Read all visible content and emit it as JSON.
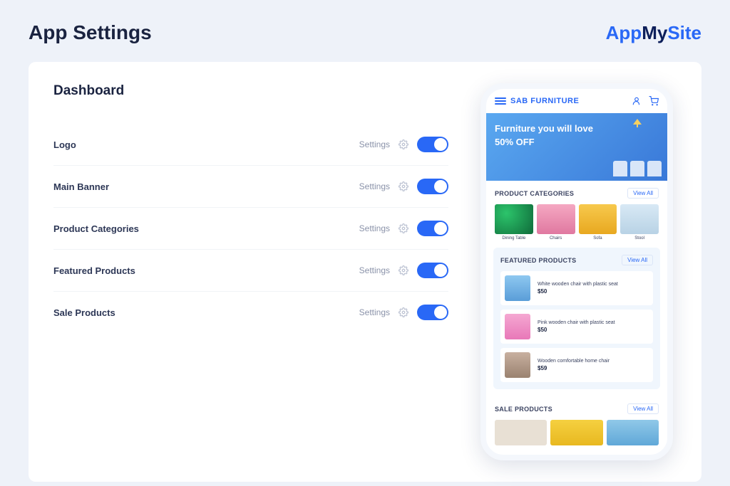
{
  "page": {
    "title": "App Settings"
  },
  "brand": {
    "part1": "App",
    "part2": "My",
    "part3": "Site"
  },
  "panel": {
    "title": "Dashboard",
    "settings_label": "Settings",
    "rows": [
      {
        "label": "Logo"
      },
      {
        "label": "Main Banner"
      },
      {
        "label": "Product Categories"
      },
      {
        "label": "Featured Products"
      },
      {
        "label": "Sale Products"
      }
    ]
  },
  "preview": {
    "app_name": "SAB FURNITURE",
    "banner": {
      "title": "Furniture you will love",
      "sub": "50% OFF"
    },
    "view_all": "View All",
    "sections": {
      "categories": {
        "title": "PRODUCT CATEGORIES",
        "items": [
          {
            "label": "Dining Table"
          },
          {
            "label": "Chairs"
          },
          {
            "label": "Sofa"
          },
          {
            "label": "Stool"
          }
        ]
      },
      "featured": {
        "title": "FEATURED PRODUCTS",
        "items": [
          {
            "name": "White wooden chair with plastic seat",
            "price": "$50"
          },
          {
            "name": "Pink wooden chair with plastic seat",
            "price": "$50"
          },
          {
            "name": "Wooden comfortable home chair",
            "price": "$59"
          }
        ]
      },
      "sale": {
        "title": "SALE PRODUCTS"
      }
    }
  }
}
